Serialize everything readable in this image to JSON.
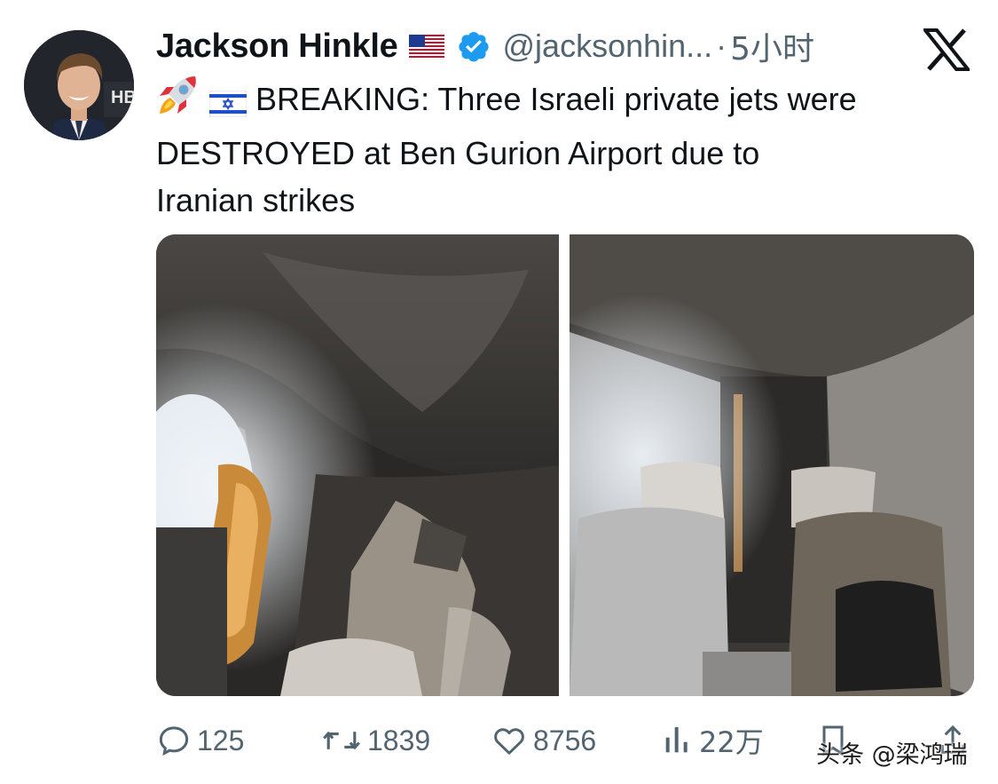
{
  "tweet": {
    "author_name": "Jackson Hinkle",
    "handle": "@jacksonhin...",
    "separator": "·",
    "time_ago": "5小时",
    "text_lines": [
      "BREAKING: Three Israeli private jets were",
      "DESTROYED at Ben Gurion Airport due to",
      "Iranian strikes"
    ],
    "emojis": [
      "rocket-emoji",
      "israel-flag-emoji"
    ],
    "name_badges": [
      "us-flag-emoji",
      "verified-badge-icon"
    ]
  },
  "media": {
    "count": 2,
    "images": [
      "burned-jet-cabin-left",
      "burned-jet-cabin-right"
    ]
  },
  "actions": {
    "replies": "125",
    "reposts": "1839",
    "likes": "8756",
    "views": "22万"
  },
  "watermark": "头条 @梁鸿瑞",
  "colors": {
    "text_primary": "#0f1419",
    "text_secondary": "#536471",
    "verified_blue": "#1d9bf0"
  }
}
